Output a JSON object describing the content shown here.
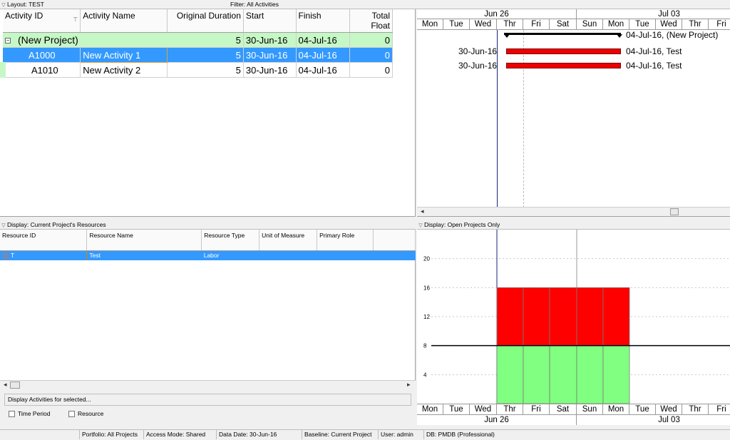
{
  "layout_label": "Layout: TEST",
  "filter_label": "Filter: All Activities",
  "activity_table": {
    "columns": [
      "Activity ID",
      "Activity Name",
      "Original Duration",
      "Start",
      "Finish",
      "Total Float"
    ],
    "group": {
      "name": "(New Project)",
      "duration": "5",
      "start": "30-Jun-16",
      "finish": "04-Jul-16",
      "float": "0"
    },
    "rows": [
      {
        "id": "A1000",
        "name": "New Activity 1",
        "duration": "5",
        "start": "30-Jun-16",
        "finish": "04-Jul-16",
        "float": "0"
      },
      {
        "id": "A1010",
        "name": "New Activity 2",
        "duration": "5",
        "start": "30-Jun-16",
        "finish": "04-Jul-16",
        "float": "0"
      }
    ]
  },
  "gantt": {
    "week1": "Jun 26",
    "week2": "Jul 03",
    "days": [
      "Mon",
      "Tue",
      "Wed",
      "Thr",
      "Fri",
      "Sat",
      "Sun",
      "Mon",
      "Tue",
      "Wed",
      "Thr",
      "Fri"
    ],
    "group_bar_label": "04-Jul-16, (New Project)",
    "bars": [
      {
        "start_label": "30-Jun-16",
        "end_label": "04-Jul-16, Test"
      },
      {
        "start_label": "30-Jun-16",
        "end_label": "04-Jul-16, Test"
      }
    ]
  },
  "resources": {
    "panel_label": "Display: Current Project's Resources",
    "columns": [
      "Resource ID",
      "Resource Name",
      "Resource Type",
      "Unit of Measure",
      "Primary Role"
    ],
    "rows": [
      {
        "id": "T",
        "name": "Test",
        "type": "Labor",
        "unit": "",
        "role": ""
      }
    ],
    "display_activities_label": "Display Activities for selected...",
    "time_period_label": "Time Period",
    "resource_label": "Resource"
  },
  "histogram": {
    "panel_label": "Display: Open Projects Only",
    "chart_data": {
      "type": "bar",
      "categories": [
        "Mon",
        "Tue",
        "Wed",
        "Thr",
        "Fri",
        "Sat",
        "Sun",
        "Mon",
        "Tue",
        "Wed",
        "Thr",
        "Fri"
      ],
      "series": [
        {
          "values": [
            0,
            0,
            0,
            8,
            8,
            8,
            8,
            8,
            0,
            0,
            0,
            0
          ],
          "color": "#80ff80"
        },
        {
          "values": [
            0,
            0,
            0,
            8,
            8,
            8,
            8,
            8,
            0,
            0,
            0,
            0
          ],
          "color": "#ff0000"
        }
      ],
      "stacked": true,
      "limit_line": 8,
      "yticks": [
        "4",
        "8",
        "12",
        "16",
        "20"
      ],
      "ylim": [
        0,
        24
      ]
    }
  },
  "statusbar": {
    "portfolio": "Portfolio: All Projects",
    "access": "Access Mode: Shared",
    "data_date": "Data Date: 30-Jun-16",
    "baseline": "Baseline: Current Project",
    "user": "User: admin",
    "db": "DB: PMDB (Professional)"
  }
}
